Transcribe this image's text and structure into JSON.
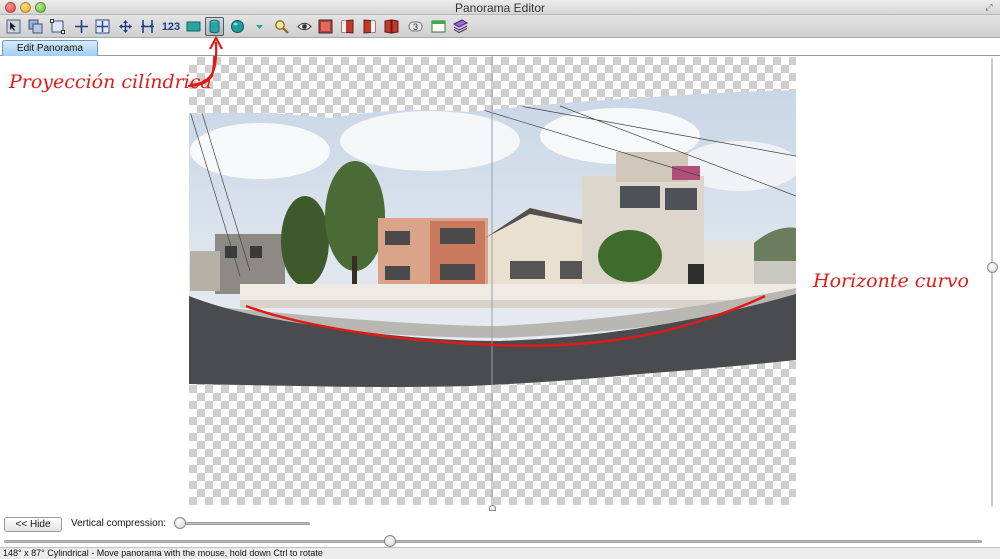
{
  "window": {
    "title": "Panorama Editor"
  },
  "toolbar": {
    "buttons": [
      {
        "name": "select-images-icon"
      },
      {
        "name": "stack-images-icon"
      },
      {
        "name": "crop-frame-icon"
      },
      {
        "name": "crosshair-icon"
      },
      {
        "name": "control-points-icon"
      },
      {
        "name": "move-arrows-icon"
      },
      {
        "name": "straighten-icon"
      },
      {
        "name": "number-images-button",
        "label": "123"
      },
      {
        "name": "rectilinear-projection-icon"
      },
      {
        "name": "cylindrical-projection-icon",
        "active": true
      },
      {
        "name": "spherical-projection-icon"
      },
      {
        "name": "dropdown-triangle-icon"
      },
      {
        "name": "zoom-icon"
      },
      {
        "name": "preview-eye-icon"
      },
      {
        "name": "full-frame-icon"
      },
      {
        "name": "left-half-icon"
      },
      {
        "name": "right-half-icon"
      },
      {
        "name": "split-view-icon"
      },
      {
        "name": "three-button",
        "label": "3"
      },
      {
        "name": "window-icon"
      },
      {
        "name": "layers-icon"
      }
    ]
  },
  "tabs": [
    {
      "label": "Edit Panorama",
      "active": true
    }
  ],
  "annotations": {
    "projection": "Proyección cilíndrica",
    "horizon": "Horizonte curvo"
  },
  "controls": {
    "hide_button": "<< Hide",
    "vertical_compression_label": "Vertical compression:"
  },
  "status": {
    "text": "148° x 87° Cylindrical - Move panorama with the mouse, hold down Ctrl to rotate"
  },
  "colors": {
    "annotation": "#e01b17",
    "tab": "#9fcdf2"
  }
}
